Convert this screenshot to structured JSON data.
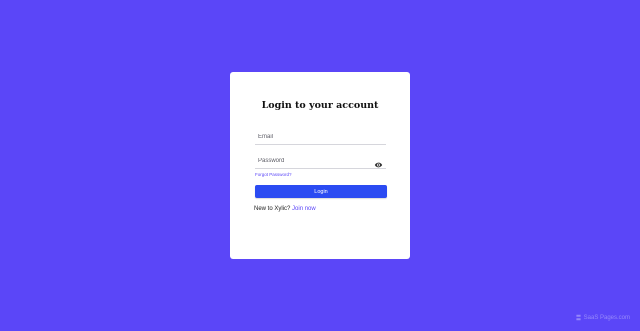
{
  "login": {
    "title": "Login to your account",
    "email_placeholder": "Email",
    "password_placeholder": "Password",
    "forgot_label": "Forgot Password?",
    "submit_label": "Login",
    "signup_prompt": "New to Xylic?",
    "signup_link": "Join now"
  },
  "icons": {
    "password_toggle": "eye-icon"
  },
  "watermark": {
    "label": "SaaS Pages.com"
  },
  "colors": {
    "background": "#5b46f8",
    "button": "#2b4bf2",
    "link": "#5b46f8",
    "card": "#ffffff"
  }
}
